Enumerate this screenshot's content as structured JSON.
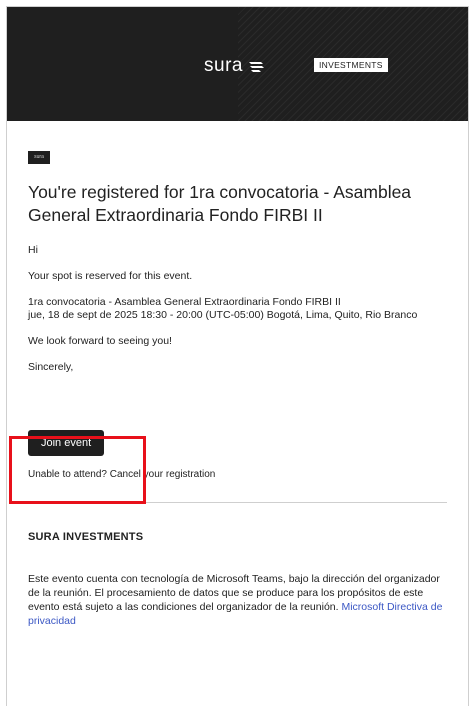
{
  "header": {
    "brand": "sura",
    "badge": "INVESTMENTS"
  },
  "org_logo": "sura",
  "title": "You're registered for 1ra convocatoria - Asamblea General Extraordinaria Fondo FIRBI II",
  "greeting": "Hi",
  "reserved": "Your spot is reserved for this event.",
  "event": {
    "name": "1ra convocatoria - Asamblea General Extraordinaria Fondo FIRBI II",
    "when": "jue, 18 de sept de 2025 18:30 - 20:00 (UTC-05:00) Bogotá, Lima, Quito, Rio Branco"
  },
  "forward": "We look forward to seeing you!",
  "signoff": "Sincerely,",
  "join_button": "Join event",
  "unable": {
    "prefix": "Unable to attend? ",
    "link": "Cancel your registration"
  },
  "company": "SURA INVESTMENTS",
  "disclaimer": {
    "text": "Este evento cuenta con tecnología de Microsoft Teams, bajo la dirección del organizador de la reunión. El procesamiento de datos que se produce para los propósitos de este evento está sujeto a las condiciones del organizador de la reunión. ",
    "link": "Microsoft Directiva de privacidad"
  },
  "colors": {
    "banner": "#1f1f1f",
    "highlight": "#e8101a",
    "link": "#3b57c4"
  }
}
